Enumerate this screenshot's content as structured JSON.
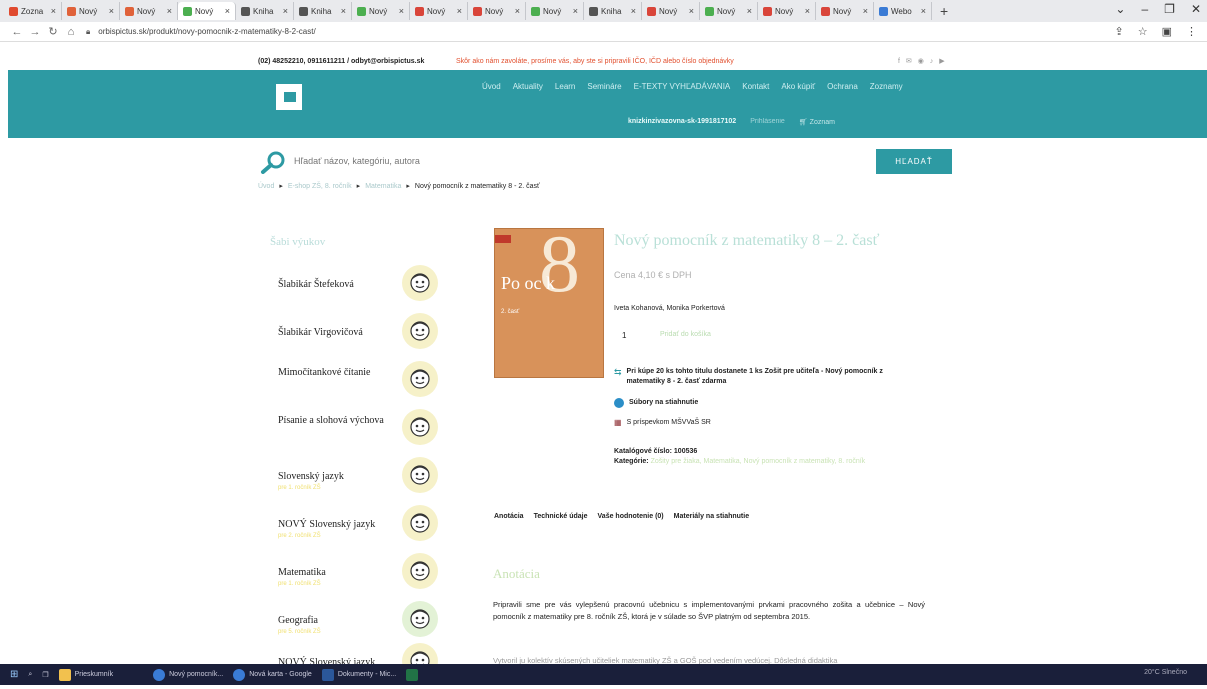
{
  "browser": {
    "tabs": [
      {
        "label": "Zozna",
        "color": "#e04a2f"
      },
      {
        "label": "Nový",
        "color": "#e0623a"
      },
      {
        "label": "Nový",
        "color": "#e0623a"
      },
      {
        "label": "Nový",
        "color": "#4caf50"
      },
      {
        "label": "Kniha",
        "color": "#555"
      },
      {
        "label": "Kniha",
        "color": "#555"
      },
      {
        "label": "Nový",
        "color": "#4caf50"
      },
      {
        "label": "Nový",
        "color": "#d9453a"
      },
      {
        "label": "Nový",
        "color": "#d9453a"
      },
      {
        "label": "Nový",
        "color": "#4caf50"
      },
      {
        "label": "Kniha",
        "color": "#555"
      },
      {
        "label": "Nový",
        "color": "#d9453a"
      },
      {
        "label": "Nový",
        "color": "#4caf50"
      },
      {
        "label": "Nový",
        "color": "#d9453a"
      },
      {
        "label": "Nový",
        "color": "#d9453a"
      },
      {
        "label": "Webo",
        "color": "#3a7bd5"
      }
    ],
    "url": "orbispictus.sk/produkt/novy-pomocnik-z-matematiky-8-2-cast/"
  },
  "topstrip": {
    "contact": "(02) 48252210, 0911611211 / odbyt@orbispictus.sk",
    "notice": "Skôr ako nám zavoláte, prosíme vás, aby ste si pripravili IČO, IČD alebo číslo objednávky"
  },
  "header": {
    "nav": [
      "Úvod",
      "Aktuality",
      "Learn",
      "Semináre",
      "E-TEXTY VYHĽADÁVANIA",
      "Kontakt",
      "Ako kúpiť",
      "Ochrana",
      "Zoznamy"
    ],
    "user": [
      "knizkinzivazovna-sk-1991817102",
      "Prihlásenie",
      "Zoznam"
    ]
  },
  "search": {
    "placeholder": "Hľadať názov, kategóriu, autora",
    "button": "HĽADAŤ"
  },
  "breadcrumb": {
    "items": [
      "Úvod",
      "E-shop ZŠ, 8. ročník",
      "Matematika"
    ],
    "current": "Nový pomocník z matematiky 8 - 2. časť"
  },
  "sidebar": {
    "title": "Šabi výukov",
    "items": [
      {
        "name": "Šlabikár Štefeková",
        "sub": ""
      },
      {
        "name": "Šlabikár Virgovičová",
        "sub": ""
      },
      {
        "name": "Mimočítankové čítanie",
        "sub": ""
      },
      {
        "name": "Písanie a slohová výchova",
        "sub": ""
      },
      {
        "name": "Slovenský jazyk",
        "sub": "pre 1. ročník ZŠ"
      },
      {
        "name": "NOVÝ Slovenský jazyk",
        "sub": "pre 2. ročník ZŠ"
      },
      {
        "name": "Matematika",
        "sub": "pre 1. ročník ZŠ"
      },
      {
        "name": "Geografia",
        "sub": "pre 5. ročník ZŠ"
      },
      {
        "name": "NOVÝ Slovenský jazyk",
        "sub": ""
      }
    ]
  },
  "product": {
    "title": "Nový pomocník z matematiky 8 – 2. časť",
    "price": "Cena 4,10 € s DPH",
    "authors": "Iveta Kohanová, Monika Porkertová",
    "qty": "1",
    "cart_button": "Pridať do košíka",
    "book_number": "8",
    "book_word": "Po oc k",
    "book_part": "2. časť",
    "bonus": "Pri kúpe 20 ks tohto titulu dostanete 1 ks Zošit pre učiteľa - Nový pomocník z matematiky 8 - 2. časť zdarma",
    "downloads": "Súbory na stiahnutie",
    "subsidy": "S príspevkom MŠVVaŠ SR",
    "catalog_label": "Katalógové číslo: 100536",
    "categories_label": "Kategórie:",
    "categories": "Zošity pre žiaka, Matematika, Nový pomocník z matematiky, 8. ročník"
  },
  "tabs": [
    "Anotácia",
    "Technické údaje",
    "Vaše hodnotenie (0)",
    "Materiály na stiahnutie"
  ],
  "annotation": {
    "title": "Anotácia",
    "text": "Pripravili sme pre vás vylepšenú pracovnú učebnicu s implementovanými prvkami pracovného zošita a učebnice – Nový pomocník z matematiky pre 8. ročník ZŠ, ktorá je v súlade so ŠVP platným od septembra 2015.",
    "text2": "Vytvoril ju kolektív skúsených učiteliek matematiky ZŠ a GOŠ pod vedením vedúcej. Dôsledná didaktika"
  },
  "taskbar": {
    "items": [
      "Prieskumník",
      "Nový pomocník...",
      "Nová karta - Google",
      "Dokumenty - Mic..."
    ],
    "weather": "20°C Slnečno"
  }
}
